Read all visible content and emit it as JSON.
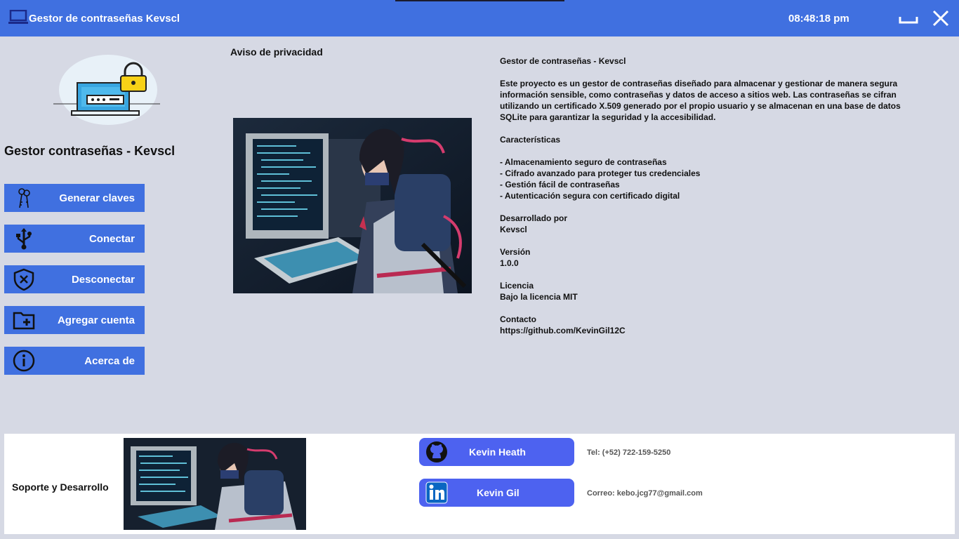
{
  "window": {
    "title": "Gestor de contraseñas Kevscl",
    "clock": "08:48:18 pm"
  },
  "sidebar": {
    "app_name": "Gestor contraseñas - Kevscl",
    "buttons": [
      {
        "label": "Generar claves",
        "icon": "keys-icon"
      },
      {
        "label": "Conectar",
        "icon": "usb-icon"
      },
      {
        "label": "Desconectar",
        "icon": "shield-x-icon"
      },
      {
        "label": "Agregar cuenta",
        "icon": "folder-add-icon"
      },
      {
        "label": "Acerca de",
        "icon": "info-icon"
      }
    ]
  },
  "main": {
    "privacy_title": "Aviso de privacidad",
    "about": {
      "heading": "Gestor de contraseñas - Kevscl",
      "description": "Este proyecto es un gestor de contraseñas diseñado para almacenar y gestionar de manera segura información sensible, como contraseñas y datos de acceso a sitios web. Las contraseñas se cifran utilizando un certificado X.509 generado por el propio usuario y se almacenan en una base de datos SQLite para garantizar la seguridad y la accesibilidad.",
      "features_title": "Características",
      "features": [
        "- Almacenamiento seguro de contraseñas",
        "- Cifrado avanzado para proteger tus credenciales",
        "- Gestión fácil de contraseñas",
        "- Autenticación segura con certificado digital"
      ],
      "developed_label": "Desarrollado por",
      "developed_value": "Kevscl",
      "version_label": "Versión",
      "version_value": "1.0.0",
      "license_label": "Licencia",
      "license_value": "Bajo la licencia MIT",
      "contact_label": "Contacto",
      "contact_value": "https://github.com/KevinGil12C"
    }
  },
  "footer": {
    "support_label": "Soporte y Desarrollo",
    "github_label": "Kevin Heath",
    "linkedin_label": "Kevin Gil",
    "phone": "Tel: (+52) 722-159-5250",
    "email": "Correo: kebo.jcg77@gmail.com"
  },
  "colors": {
    "accent": "#4070e0",
    "background": "#d6d9e4",
    "social": "#4d62f0"
  }
}
